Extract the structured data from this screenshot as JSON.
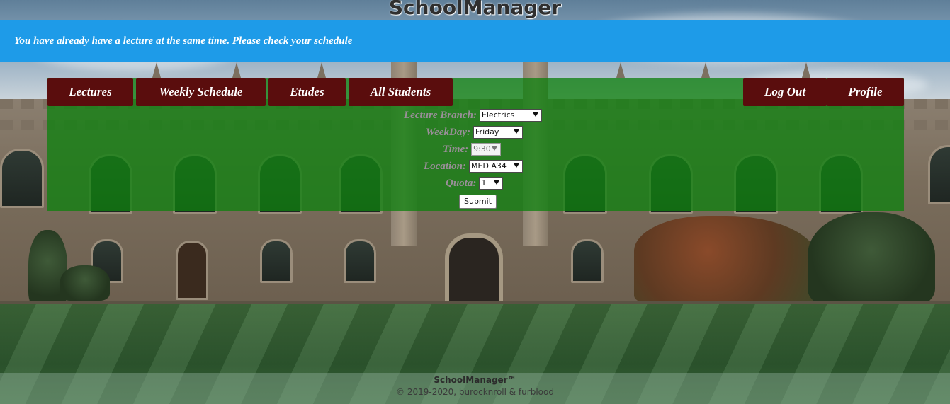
{
  "app": {
    "title": "SchoolManager"
  },
  "alert": {
    "message": "You have already have a lecture at the same time. Please check your schedule"
  },
  "nav": {
    "lectures": "Lectures",
    "weekly_schedule": "Weekly Schedule",
    "etudes": "Etudes",
    "all_students": "All Students",
    "log_out": "Log Out",
    "profile": "Profile"
  },
  "form": {
    "lecture_branch": {
      "label": "Lecture Branch:",
      "value": "Electrics"
    },
    "weekday": {
      "label": "WeekDay:",
      "value": "Friday"
    },
    "time": {
      "label": "Time:",
      "value": "9:30",
      "disabled": true
    },
    "location": {
      "label": "Location:",
      "value": "MED A34"
    },
    "quota": {
      "label": "Quota:",
      "value": "1"
    },
    "submit_label": "Submit"
  },
  "footer": {
    "brand": "SchoolManager™",
    "copyright": "© 2019-2020, burocknroll & furblood"
  },
  "colors": {
    "alert_bg": "#1e9be8",
    "nav_bg": "#5a0d0d",
    "panel_bg": "rgba(16,128,16,0.78)"
  }
}
